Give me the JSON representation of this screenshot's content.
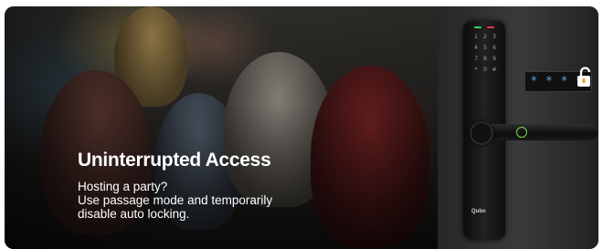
{
  "banner": {
    "headline": "Uninterrupted Access",
    "body_lines": [
      "Hosting a party?",
      "Use passage mode and temporarily",
      "disable auto locking."
    ]
  },
  "lock": {
    "brand": "Qubo",
    "keypad_keys": [
      "1",
      "2",
      "3",
      "4",
      "5",
      "6",
      "7",
      "8",
      "9",
      "*",
      "0",
      "#"
    ],
    "code_display": "* * * *",
    "colors": {
      "led_green": "#35d36a",
      "led_red": "#e23b3b",
      "fingerprint_ring": "#7ddc4a",
      "code_text": "#5aa0e6"
    },
    "icons": [
      "unlock-icon",
      "fingerprint-icon"
    ]
  }
}
